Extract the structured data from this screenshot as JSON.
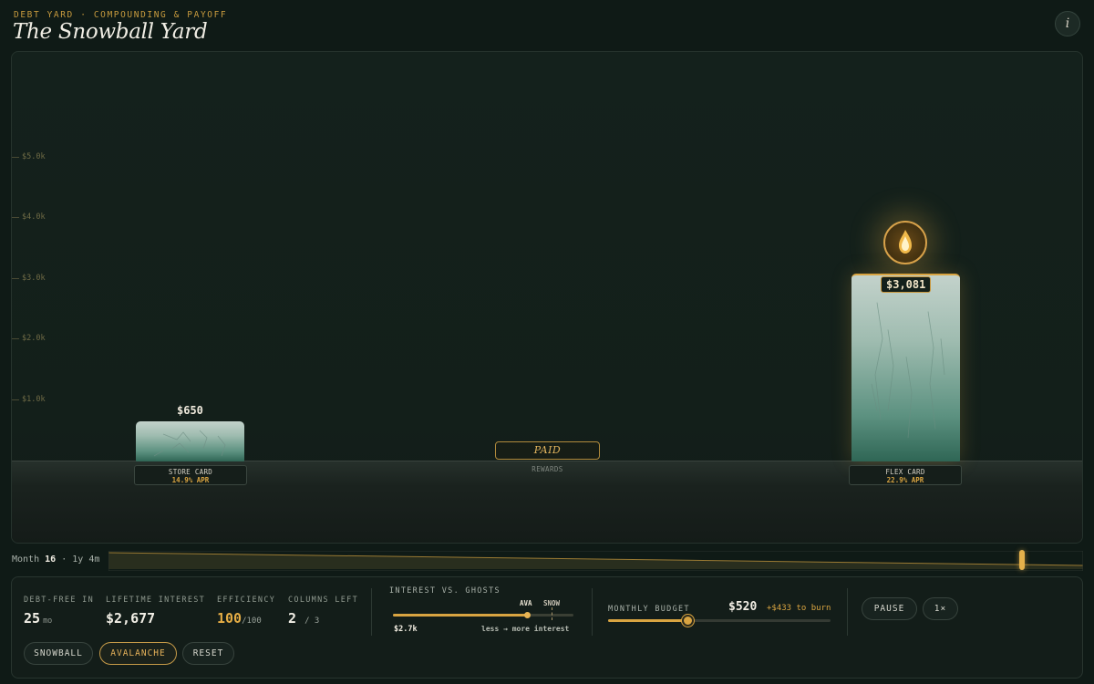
{
  "header": {
    "eyebrow": "DEBT YARD · COMPOUNDING & PAYOFF",
    "title": "The Snowball Yard",
    "info_label": "i"
  },
  "yard": {
    "axis_ticks": [
      "$5.0k",
      "$4.0k",
      "$3.0k",
      "$2.0k",
      "$1.0k"
    ],
    "columns": [
      {
        "name": "STORE CARD",
        "apr": "14.9% APR",
        "balance": "$650",
        "status": "active"
      },
      {
        "name": "REWARDS",
        "status_label": "PAID",
        "status": "paid"
      },
      {
        "name": "FLEX CARD",
        "apr": "22.9% APR",
        "balance": "$3,081",
        "status": "target"
      }
    ]
  },
  "timeline": {
    "month_label": "Month",
    "month_value": "16",
    "duration": "· 1y 4m"
  },
  "stats": {
    "debt_free": {
      "label": "DEBT-FREE IN",
      "value": "25",
      "unit": "mo"
    },
    "lifetime_interest": {
      "label": "LIFETIME INTEREST",
      "value": "$2,677"
    },
    "efficiency": {
      "label": "EFFICIENCY",
      "value": "100",
      "unit": "/100"
    },
    "columns_left": {
      "label": "COLUMNS LEFT",
      "value": "2",
      "unit": "/ 3"
    }
  },
  "interest_vs_ghosts": {
    "title": "INTEREST VS. GHOSTS",
    "ava_label": "AVA",
    "snow_label": "SNOW",
    "value": "$2.7k",
    "legend": "less → more interest",
    "fill_fraction": 0.74
  },
  "budget": {
    "label": "MONTHLY BUDGET",
    "value": "$520",
    "burn": "+$433 to burn",
    "fill_fraction": 0.36
  },
  "controls": {
    "pause": "PAUSE",
    "speed": "1×",
    "snowball": "SNOWBALL",
    "avalanche": "AVALANCHE",
    "reset": "RESET",
    "active_strategy": "avalanche"
  },
  "colors": {
    "accent": "#d9a441",
    "background": "#0f1a16"
  }
}
